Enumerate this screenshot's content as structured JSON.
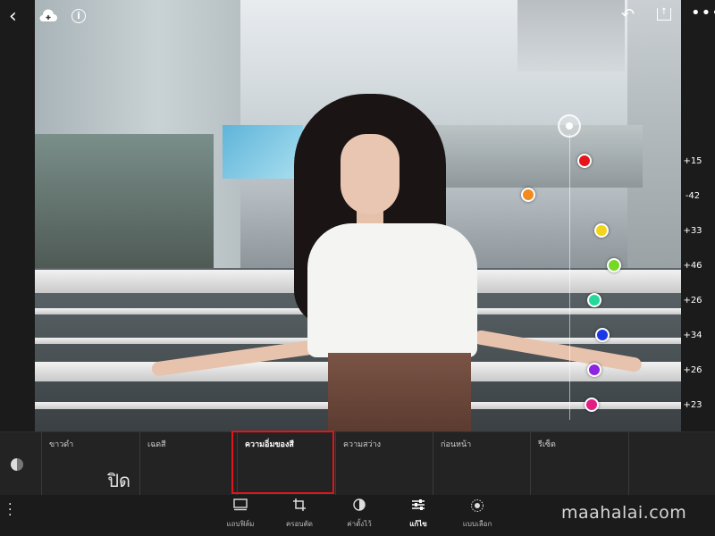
{
  "header": {
    "back_icon": "chevron-left-icon",
    "cloud_icon": "cloud-add-icon",
    "info_glyph": "i",
    "undo_icon": "undo-icon",
    "share_icon": "share-icon",
    "more_glyph": "•••"
  },
  "color_mix": {
    "dots": [
      {
        "color": "#e8141b",
        "value": "+15"
      },
      {
        "color": "#f28a1d",
        "value": "-42"
      },
      {
        "color": "#f2d41a",
        "value": "+33"
      },
      {
        "color": "#76d824",
        "value": "+46"
      },
      {
        "color": "#24d89a",
        "value": "+26"
      },
      {
        "color": "#1c37e6",
        "value": "+34"
      },
      {
        "color": "#8d24e2",
        "value": "+26"
      },
      {
        "color": "#e21e84",
        "value": "+23"
      }
    ]
  },
  "panel": {
    "tabs": [
      {
        "label": "ขาวดำ",
        "value": "ปิด"
      },
      {
        "label": "เฉดสี",
        "value": ""
      },
      {
        "label": "ความอิ่มของสี",
        "value": "",
        "active": true
      },
      {
        "label": "ความสว่าง",
        "value": ""
      },
      {
        "label": "ก่อนหน้า",
        "value": ""
      },
      {
        "label": "รีเซ็ต",
        "value": ""
      }
    ]
  },
  "toolbar": {
    "items": [
      {
        "icon": "filmstrip-icon",
        "label": "แถบฟิล์ม"
      },
      {
        "icon": "crop-icon",
        "label": "ครอบตัด"
      },
      {
        "icon": "presets-icon",
        "label": "ค่าตั้งไว้"
      },
      {
        "icon": "sliders-icon",
        "label": "แก้ไข",
        "active": true
      },
      {
        "icon": "selective-icon",
        "label": "แบบเลือก"
      }
    ]
  },
  "watermark": "maahalai.com"
}
